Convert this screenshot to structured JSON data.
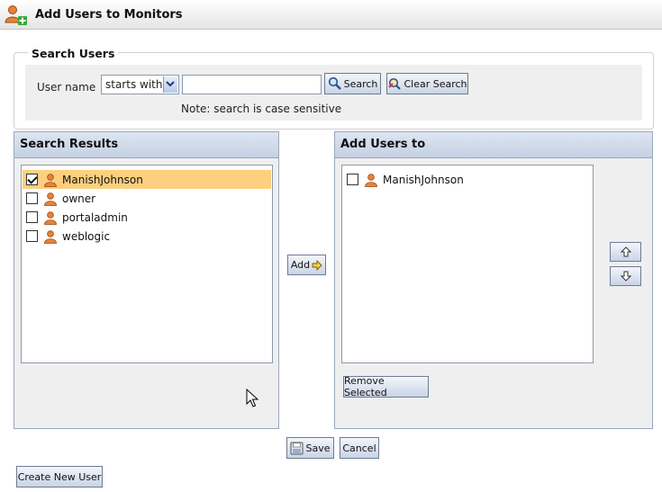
{
  "window": {
    "title": "Add Users to Monitors"
  },
  "search": {
    "legend": "Search Users",
    "username_label": "User name",
    "match_mode": "starts with",
    "query_value": "",
    "search_button": "Search",
    "clear_button": "Clear Search",
    "note": "Note: search is case sensitive"
  },
  "results": {
    "title": "Search Results",
    "items": [
      {
        "label": "ManishJohnson",
        "checked": true,
        "selected": true
      },
      {
        "label": "owner",
        "checked": false,
        "selected": false
      },
      {
        "label": "portaladmin",
        "checked": false,
        "selected": false
      },
      {
        "label": "weblogic",
        "checked": false,
        "selected": false
      }
    ]
  },
  "add_button": "Add",
  "target": {
    "title": "Add Users to",
    "items": [
      {
        "label": "ManishJohnson",
        "checked": false
      }
    ],
    "remove_button": "Remove Selected"
  },
  "footer": {
    "save_label": "Save",
    "cancel_label": "Cancel",
    "create_user_label": "Create New User"
  },
  "colors": {
    "accent": "#c5d1e3",
    "selection": "#fdcf7f",
    "user_icon": "#e07a2a"
  }
}
